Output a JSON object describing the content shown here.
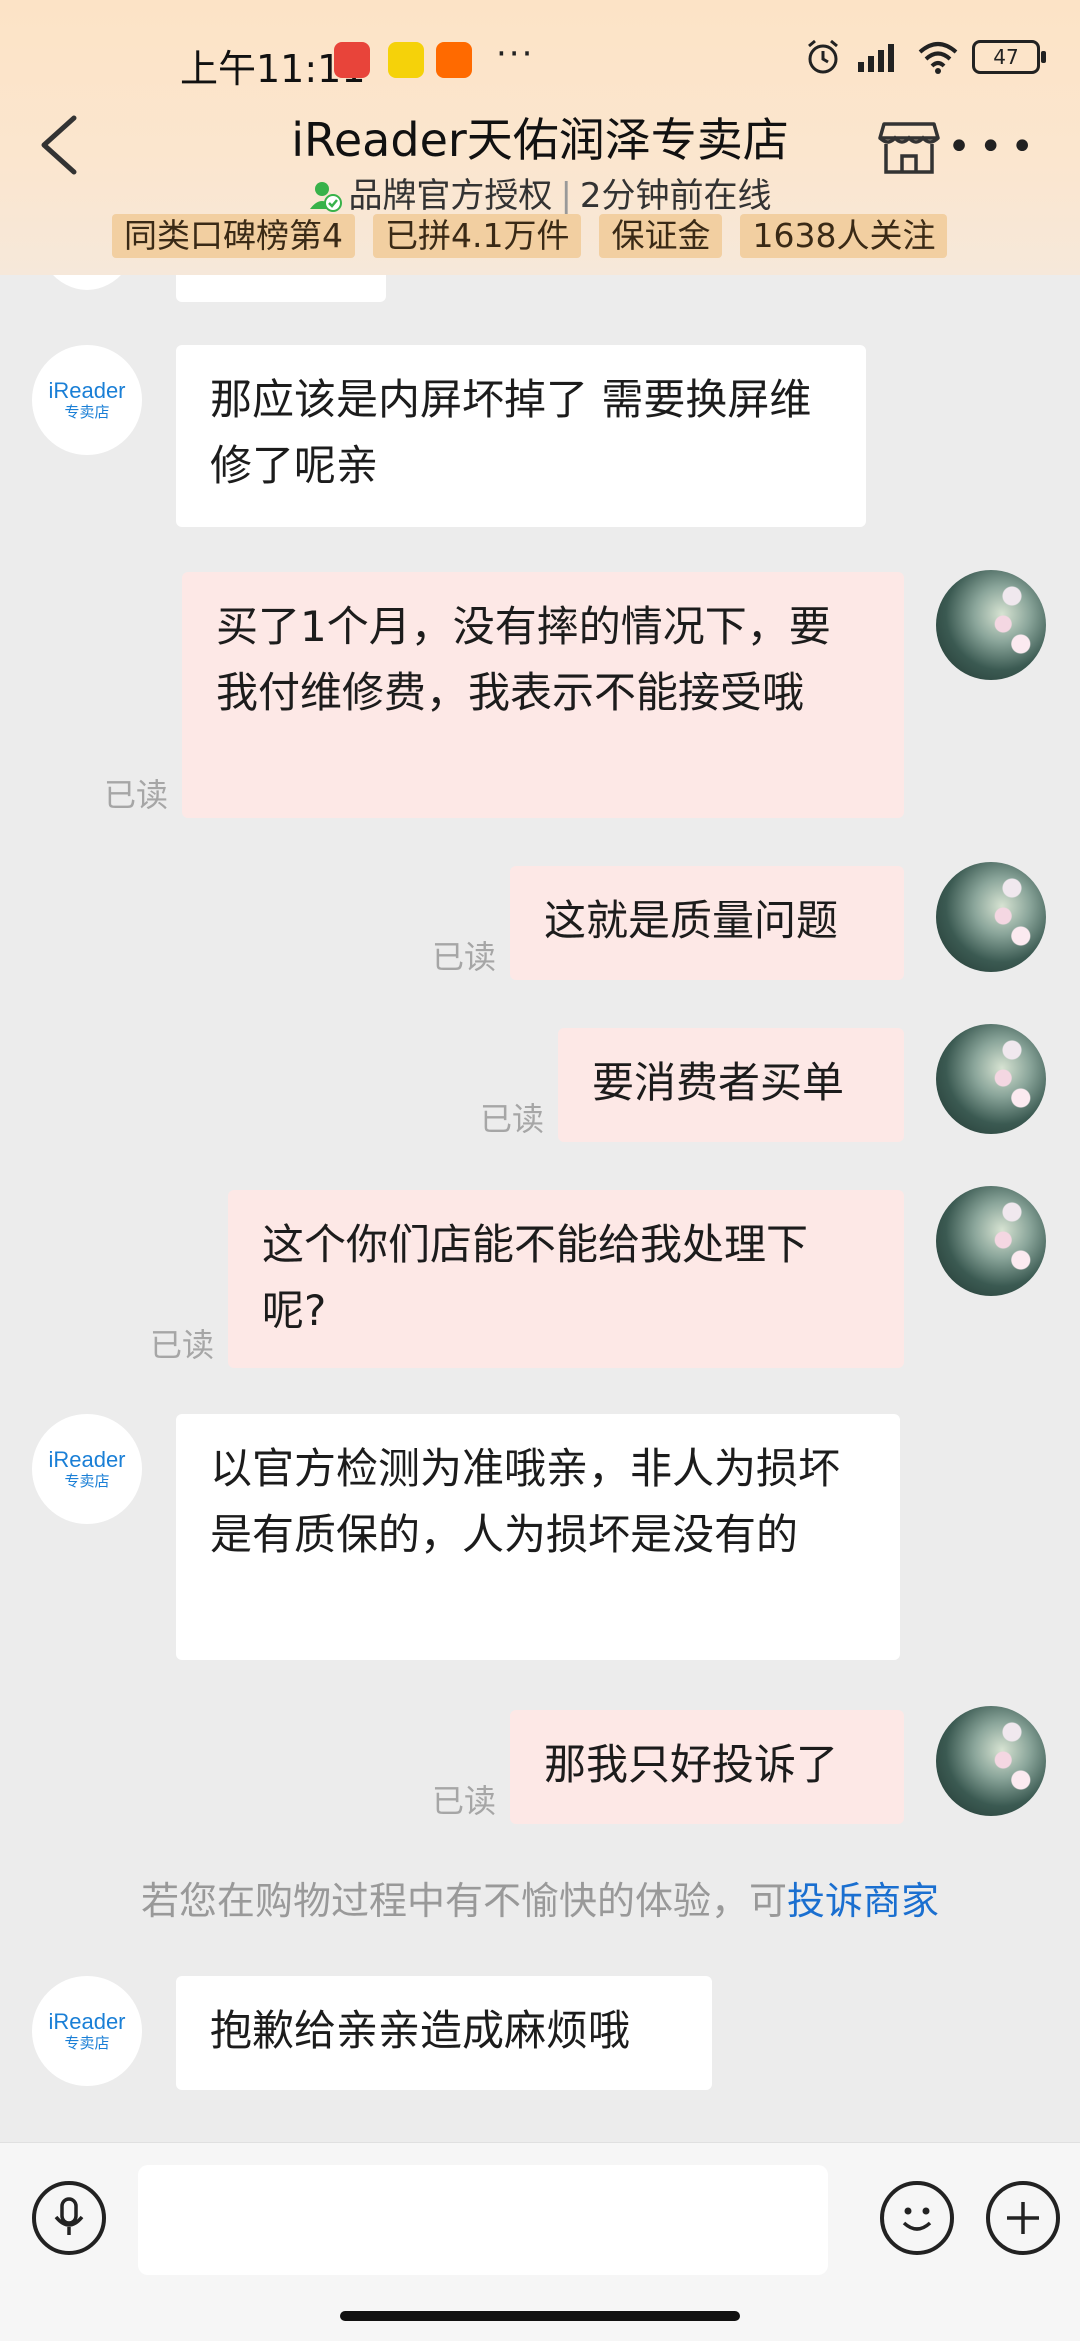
{
  "status_bar": {
    "time": "上午11:11",
    "dots": "···",
    "battery": "47"
  },
  "header": {
    "title": "iReader天佑润泽专卖店",
    "verified_label": "品牌官方授权",
    "online_status": "2分钟前在线",
    "tags": [
      "同类口碑榜第4",
      "已拼4.1万件",
      "保证金",
      "1638人关注"
    ]
  },
  "shop_avatar": {
    "brand": "iReader",
    "sub": "专卖店"
  },
  "read_label": "已读",
  "messages": [
    {
      "side": "left",
      "text": "那应该是内屏坏掉了 需要换屏维修了呢亲"
    },
    {
      "side": "right",
      "text": "买了1个月，没有摔的情况下，要我付维修费，我表示不能接受哦",
      "read": "已读"
    },
    {
      "side": "right",
      "text": "这就是质量问题",
      "read": "已读"
    },
    {
      "side": "right",
      "text": "要消费者买单",
      "read": "已读"
    },
    {
      "side": "right",
      "text": "这个你们店能不能给我处理下呢?",
      "read": "已读"
    },
    {
      "side": "left",
      "text": "以官方检测为准哦亲，非人为损坏是有质保的，人为损坏是没有的"
    },
    {
      "side": "right",
      "text": "那我只好投诉了",
      "read": "已读"
    },
    {
      "side": "left",
      "text": "抱歉给亲亲造成麻烦哦"
    }
  ],
  "system_note": {
    "text": "若您在购物过程中有不愉快的体验，可",
    "link": "投诉商家"
  },
  "input": {
    "placeholder": ""
  },
  "icons": {
    "back": "chevron-left-icon",
    "store": "store-icon",
    "more": "more-icon",
    "voice": "microphone-icon",
    "emoji": "emoji-icon",
    "plus": "plus-icon"
  },
  "colors": {
    "header_bg": "#fce3c6",
    "tag_bg": "#f2cfa1",
    "right_bubble": "#fde8e6",
    "link": "#1a6fd0"
  }
}
